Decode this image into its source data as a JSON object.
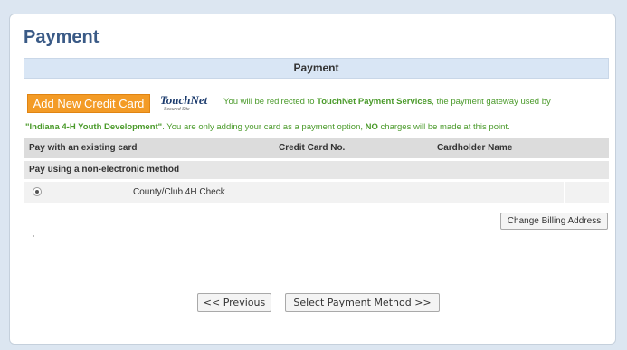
{
  "page": {
    "title": "Payment"
  },
  "section": {
    "header": "Payment"
  },
  "add_card": {
    "label": "Add New Credit Card"
  },
  "touchnet": {
    "brand": "TouchNet",
    "tagline": "Secured Site"
  },
  "notice": {
    "line1_pre": "You will be redirected to ",
    "line1_bold": "TouchNet Payment Services",
    "line1_post": ", the payment gateway used by",
    "line2_bold": "\"Indiana 4-H Youth Development\"",
    "line2_mid": ". You are only adding your card as a payment option, ",
    "line2_bold2": "NO",
    "line2_post": " charges will be made at this point."
  },
  "cards_table": {
    "columns": [
      "Pay with an existing card",
      "Credit Card No.",
      "Cardholder Name"
    ]
  },
  "nonelectronic": {
    "header": "Pay using a non-electronic method",
    "options": [
      {
        "label": "County/Club 4H Check",
        "selected": true
      }
    ]
  },
  "buttons": {
    "change_billing": "Change Billing Address",
    "previous": "<< Previous",
    "next": "Select Payment Method >>"
  },
  "colors": {
    "accent_orange": "#f39b26",
    "notice_green": "#4a9a2a",
    "title_blue": "#3a5a86"
  }
}
